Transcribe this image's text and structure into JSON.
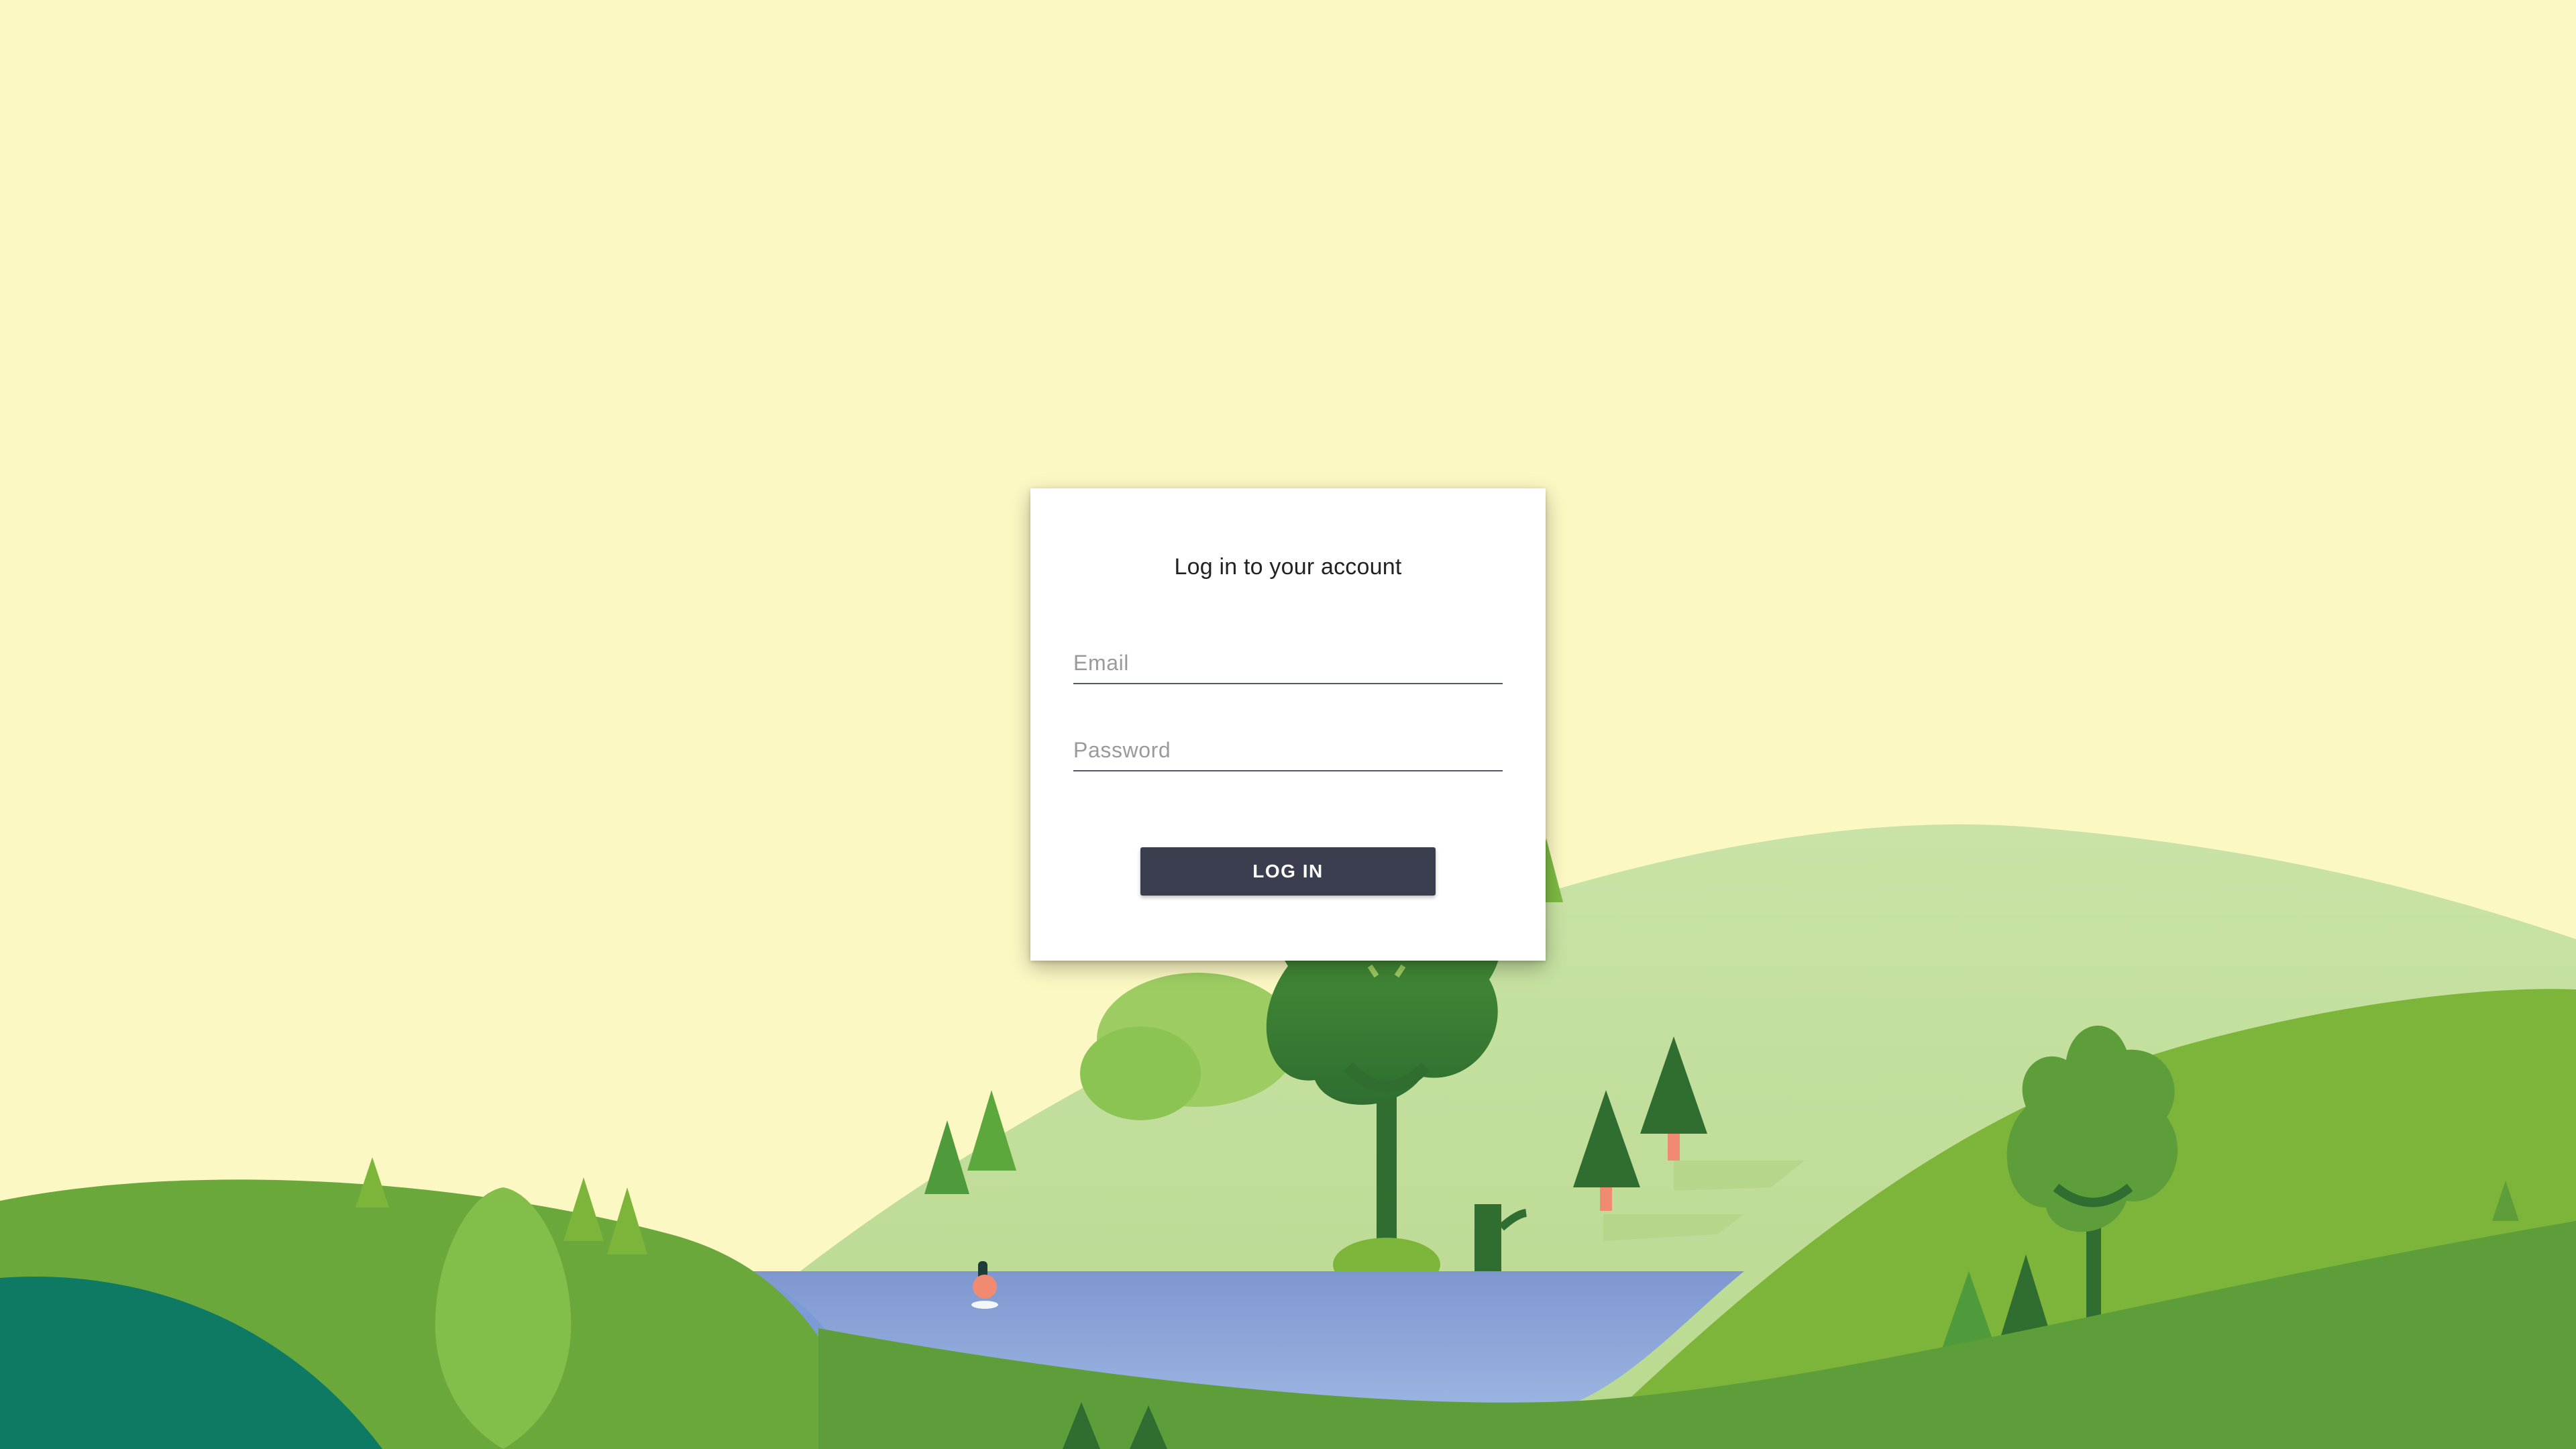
{
  "login": {
    "title": "Log in to your account",
    "email_placeholder": "Email",
    "password_placeholder": "Password",
    "submit_label": "LOG IN"
  },
  "colors": {
    "sky": "#fcf8c4",
    "card": "#ffffff",
    "button": "#3a3e4e",
    "hill_light": "#c5e0a0",
    "hill_mid": "#7db53b",
    "hill_dark": "#5e9e3a",
    "teal_hill": "#0e7a64",
    "water": "#8fa9dc",
    "tree_dark": "#2f6e30",
    "trunk_accent": "#f08a70"
  }
}
